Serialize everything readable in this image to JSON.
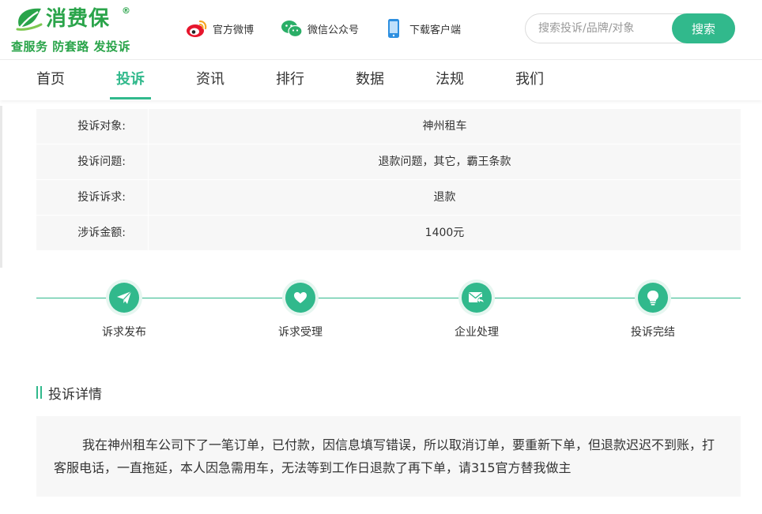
{
  "header": {
    "logo_text": "消费保",
    "logo_reg": "®",
    "slogan": "查服务 防套路 发投诉",
    "links": [
      {
        "label": "官方微博",
        "icon": "weibo-icon"
      },
      {
        "label": "微信公众号",
        "icon": "wechat-icon"
      },
      {
        "label": "下载客户端",
        "icon": "mobile-phone-icon"
      }
    ],
    "search": {
      "placeholder": "搜索投诉/品牌/对象",
      "button": "搜索"
    }
  },
  "nav": {
    "items": [
      "首页",
      "投诉",
      "资讯",
      "排行",
      "数据",
      "法规",
      "我们"
    ],
    "active": "投诉"
  },
  "info": {
    "rows": [
      {
        "label": "投诉对象:",
        "value": "神州租车"
      },
      {
        "label": "投诉问题:",
        "value": "退款问题，其它，霸王条款"
      },
      {
        "label": "投诉诉求:",
        "value": "退款"
      },
      {
        "label": "涉诉金额:",
        "value": "1400元"
      }
    ]
  },
  "progress": {
    "steps": [
      {
        "label": "诉求发布",
        "icon": "paper-plane-icon"
      },
      {
        "label": "诉求受理",
        "icon": "heart-icon"
      },
      {
        "label": "企业处理",
        "icon": "envelope-reply-icon"
      },
      {
        "label": "投诉完结",
        "icon": "lightbulb-icon"
      }
    ]
  },
  "details": {
    "title": "投诉详情",
    "text": "我在神州租车公司下了一笔订单，已付款，因信息填写错误，所以取消订单，要重新下单，但退款迟迟不到账，打客服电话，一直拖延，本人因急需用车，无法等到工作日退款了再下单，请315官方替我做主"
  },
  "colors": {
    "accent": "#31b98c",
    "logo_green": "#2aa44a",
    "row_bg": "#f7f7f7"
  }
}
